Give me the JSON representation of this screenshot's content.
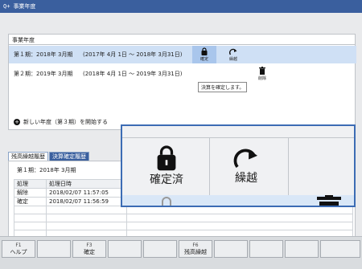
{
  "window": {
    "title": "事業年度",
    "icon": "plus-icon"
  },
  "fiscal": {
    "section_label": "事業年度",
    "rows": [
      {
        "period": "第１期：2018年 3月期",
        "range": "(2017年 4月 1日 ～ 2018年 3月31日)",
        "actions": [
          "確定",
          "繰越"
        ]
      },
      {
        "period": "第２期：2019年 3月期",
        "range": "(2018年 4月 1日 ～ 2019年 3月31日)",
        "actions": [
          "削除"
        ]
      }
    ],
    "tooltip": "決算を確定します。",
    "new_year_label": "新しい年度（第３期）を開始する"
  },
  "history": {
    "tabs": [
      "残高繰越履歴",
      "決算確定履歴"
    ],
    "active_tab": 1,
    "period_label": "第１期：2018年 3月期",
    "columns": [
      "処理",
      "処理日時"
    ],
    "rows": [
      [
        "解除",
        "2018/02/07 11:57:05"
      ],
      [
        "確定",
        "2018/02/07 11:56:59"
      ]
    ]
  },
  "fkeys": [
    {
      "num": "F1",
      "label": "ヘルプ"
    },
    {
      "num": "",
      "label": ""
    },
    {
      "num": "F3",
      "label": "確定"
    },
    {
      "num": "",
      "label": ""
    },
    {
      "num": "F6",
      "label": "残高繰越"
    },
    {
      "num": "",
      "label": ""
    }
  ],
  "zoom": {
    "confirm_label": "確定済",
    "carryover_label": "繰越"
  },
  "colors": {
    "titlebar": "#3a5f9e",
    "selected_row": "#cfe0f5",
    "zoom_border": "#3c6cb4"
  }
}
